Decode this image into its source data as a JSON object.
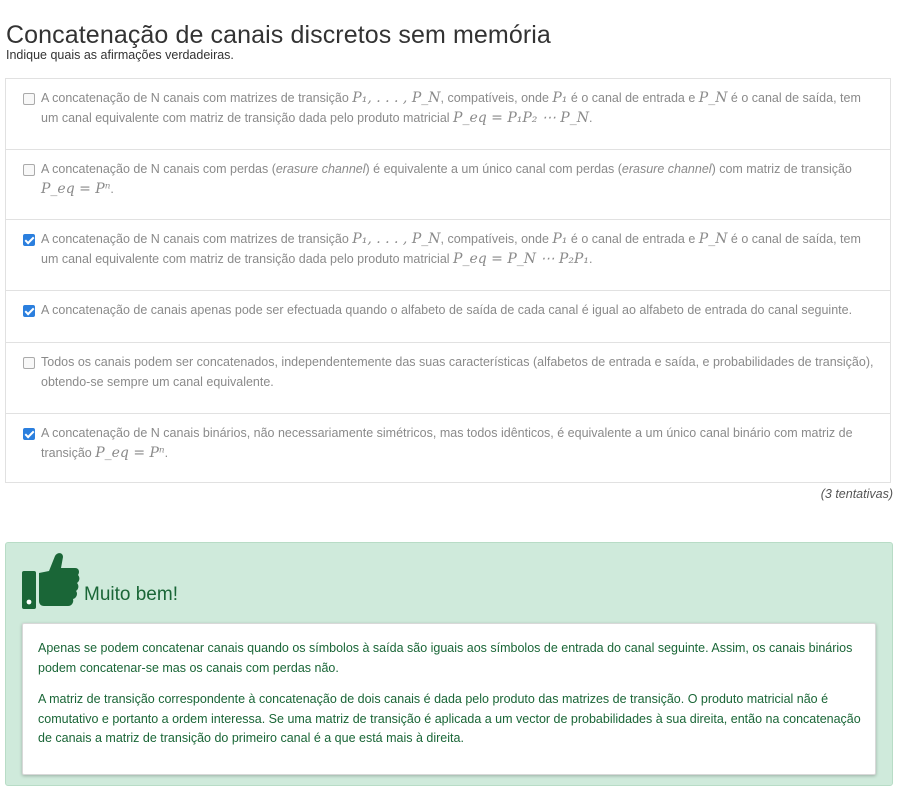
{
  "page": {
    "title": "Concatenação de canais discretos sem memória",
    "instruction": "Indique quais as afirmações verdadeiras."
  },
  "options": [
    {
      "checked": false,
      "t1": "A concatenação de N canais com matrizes de transição ",
      "m1": "P₁, . . . , P_N",
      "t2": ", compatíveis, onde ",
      "m2": "P₁",
      "t3": " é o canal de entrada e ",
      "m3": "P_N",
      "t4": " é o canal de saída, tem um canal equivalente com matriz de transição dada pelo produto matricial ",
      "m4": "P_eq = P₁P₂ ⋯ P_N",
      "t5": "."
    },
    {
      "checked": false,
      "t1": "A concatenação de N canais com perdas (",
      "em1": "erasure channel",
      "t2": ") é equivalente a um único canal com perdas (",
      "em2": "erasure channel",
      "t3": ") com matriz de transição ",
      "m1": "P_eq = Pⁿ",
      "t4": "."
    },
    {
      "checked": true,
      "t1": "A concatenação de N canais com matrizes de transição ",
      "m1": "P₁, . . . , P_N",
      "t2": ", compatíveis, onde ",
      "m2": "P₁",
      "t3": " é o canal de entrada e ",
      "m3": "P_N",
      "t4": " é o canal de saída, tem um canal equivalente com matriz de transição dada pelo produto matricial ",
      "m4": "P_eq = P_N ⋯ P₂P₁",
      "t5": "."
    },
    {
      "checked": true,
      "t1": "A concatenação de canais apenas pode ser efectuada quando o alfabeto de saída de cada canal é igual ao alfabeto de entrada do canal seguinte."
    },
    {
      "checked": false,
      "t1": "Todos os canais podem ser concatenados, independentemente das suas características (alfabetos de entrada e saída, e probabilidades de transição), obtendo-se sempre um canal equivalente."
    },
    {
      "checked": true,
      "t1": "A concatenação de N canais binários, não necessariamente simétricos, mas todos idênticos, é equivalente a um único canal binário com matriz de transição ",
      "m1": "P_eq = Pⁿ",
      "t2": "."
    }
  ],
  "attempts": "(3 tentativas)",
  "feedback": {
    "icon": "thumbs-up-icon",
    "title": "Muito bem!",
    "paragraph1": "Apenas se podem concatenar canais quando os símbolos à saída são iguais aos símbolos de entrada do canal seguinte. Assim, os canais binários podem concatenar-se mas os canais com perdas não.",
    "paragraph2": "A matriz de transição correspondente à concatenação de dois canais é dada pelo produto das matrizes de transição. O produto matricial não é comutativo e portanto a ordem interessa. Se uma matriz de transição é aplicada a um vector de probabilidades à sua direita, então na concatenação de canais a matriz de transição do primeiro canal é a que está mais à direita."
  },
  "colors": {
    "accent": "#2b7fde",
    "feedback_bg": "#cfeadb",
    "feedback_text": "#1a6637"
  }
}
